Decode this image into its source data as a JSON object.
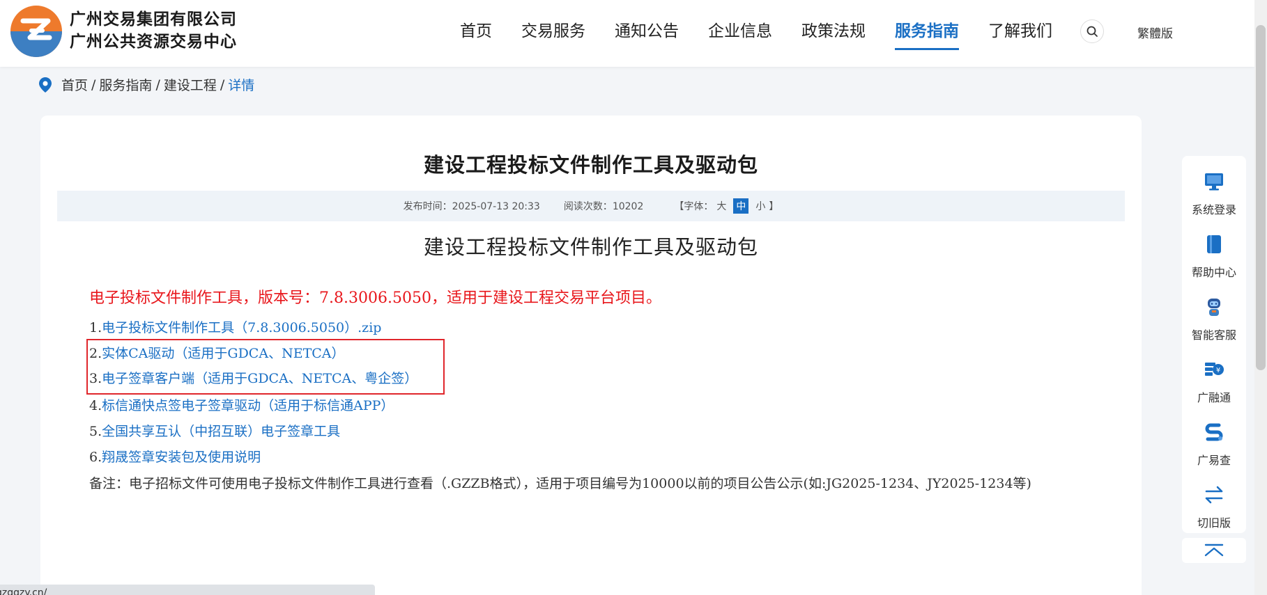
{
  "header": {
    "brand_line1": "广州交易集团有限公司",
    "brand_line2": "广州公共资源交易中心",
    "nav": [
      {
        "label": "首页"
      },
      {
        "label": "交易服务"
      },
      {
        "label": "通知公告"
      },
      {
        "label": "企业信息"
      },
      {
        "label": "政策法规"
      },
      {
        "label": "服务指南",
        "active": true
      },
      {
        "label": "了解我们"
      }
    ],
    "traditional_label": "繁體版"
  },
  "breadcrumb": {
    "home": "首页",
    "level1": "服务指南",
    "level2": "建设工程",
    "current": "详情",
    "separator": "/"
  },
  "article": {
    "title": "建设工程投标文件制作工具及驱动包",
    "publish_label": "发布时间：",
    "publish_time": "2025-07-13 20:33",
    "views_label": "阅读次数：",
    "views": "10202",
    "font_open": "【字体：",
    "font_large": "大",
    "font_medium": "中",
    "font_small": "小",
    "font_close": "】",
    "subtitle": "建设工程投标文件制作工具及驱动包",
    "notice": "电子投标文件制作工具，版本号：7.8.3006.5050，适用于建设工程交易平台项目。",
    "items": [
      {
        "num": "1.",
        "text": "电子投标文件制作工具（7.8.3006.5050）.zip"
      },
      {
        "num": "2.",
        "text": "实体CA驱动（适用于GDCA、NETCA）"
      },
      {
        "num": "3.",
        "text": "电子签章客户端（适用于GDCA、NETCA、粤企签）"
      },
      {
        "num": "4.",
        "text": "标信通快点签电子签章驱动（适用于标信通APP）"
      },
      {
        "num": "5.",
        "text": "全国共享互认（中招互联）电子签章工具"
      },
      {
        "num": "6.",
        "text": "翔晟签章安装包及使用说明"
      }
    ],
    "remark": "备注：电子招标文件可使用电子投标文件制作工具进行查看（.GZZB格式），适用于项目编号为10000以前的项目公告公示(如:JG2025-1234、JY2025-1234等)"
  },
  "sidebar": {
    "items": [
      {
        "label": "系统登录",
        "icon": "monitor-icon"
      },
      {
        "label": "帮助中心",
        "icon": "book-icon"
      },
      {
        "label": "智能客服",
        "icon": "robot-icon"
      },
      {
        "label": "广融通",
        "icon": "finance-icon"
      },
      {
        "label": "广易查",
        "icon": "search-s-icon"
      },
      {
        "label": "切旧版",
        "icon": "switch-icon"
      }
    ]
  },
  "statusbar": {
    "url": "gzggzy.cn/"
  },
  "colors": {
    "accent": "#1a6fc4",
    "notice_red": "#e8161b",
    "highlight_border": "#e0262b"
  }
}
